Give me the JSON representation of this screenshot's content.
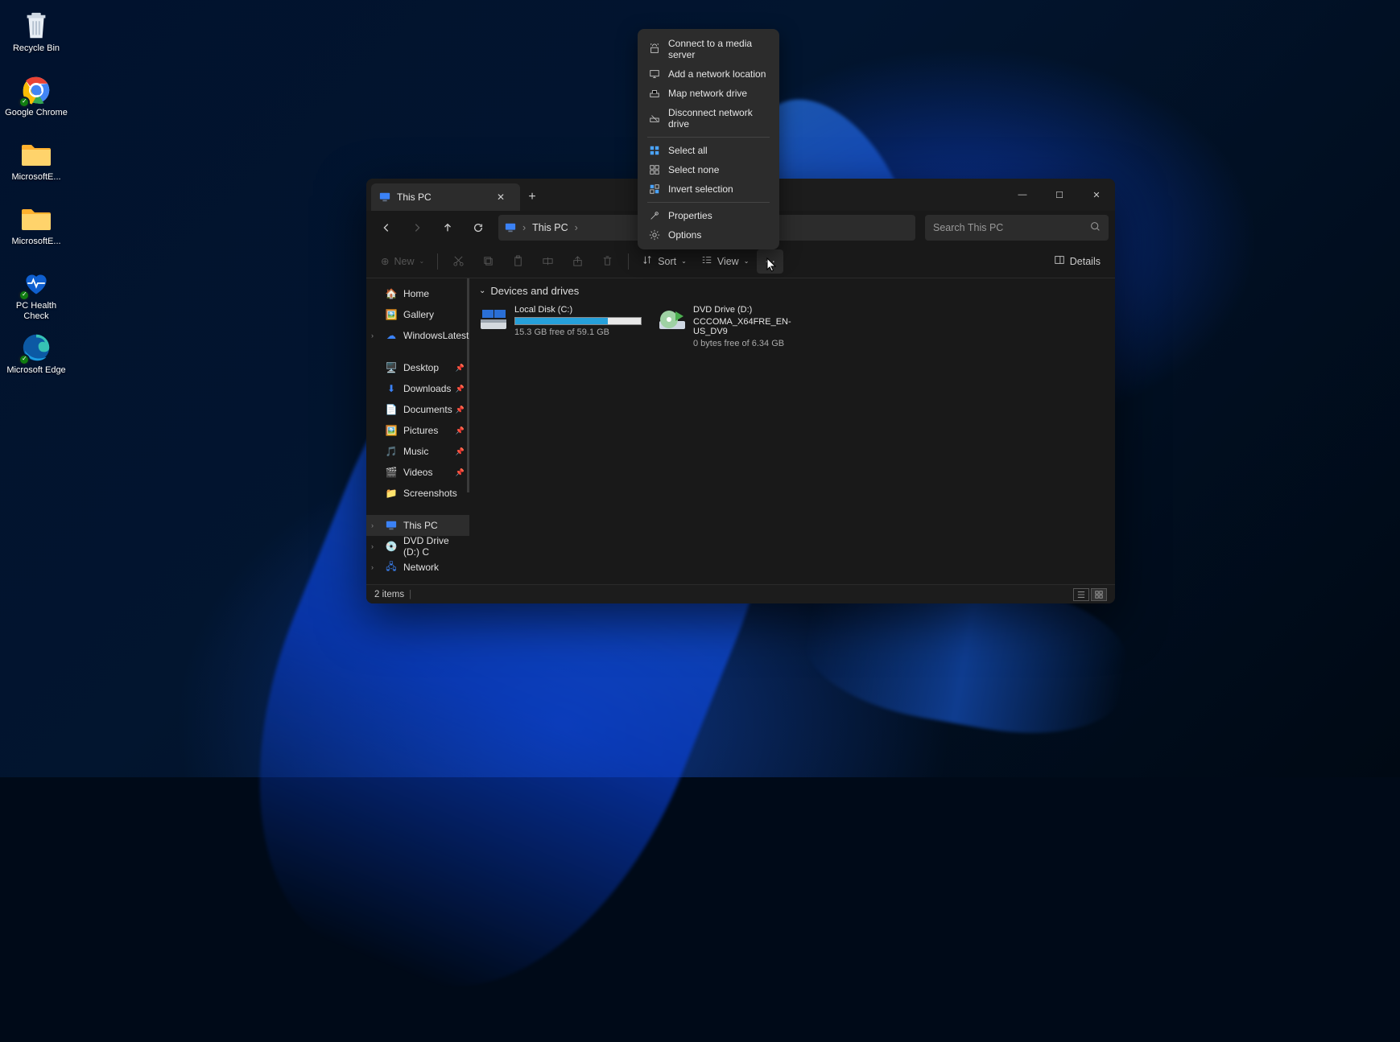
{
  "desktop": {
    "icons": [
      {
        "name": "recycle-bin",
        "label": "Recycle Bin"
      },
      {
        "name": "google-chrome",
        "label": "Google Chrome"
      },
      {
        "name": "microsoft-edge-folder-1",
        "label": "MicrosoftE..."
      },
      {
        "name": "microsoft-edge-folder-2",
        "label": "MicrosoftE..."
      },
      {
        "name": "pc-health-check",
        "label": "PC Health Check"
      },
      {
        "name": "microsoft-edge",
        "label": "Microsoft Edge"
      }
    ]
  },
  "explorer": {
    "tab_title": "This PC",
    "breadcrumb": {
      "root_icon": "pc-icon",
      "location": "This PC"
    },
    "search_placeholder": "Search This PC",
    "toolbar": {
      "new_label": "New",
      "sort_label": "Sort",
      "view_label": "View",
      "details_label": "Details"
    },
    "sidebar": {
      "home": "Home",
      "gallery": "Gallery",
      "windowslatest": "WindowsLatest",
      "desktop": "Desktop",
      "downloads": "Downloads",
      "documents": "Documents",
      "pictures": "Pictures",
      "music": "Music",
      "videos": "Videos",
      "screenshots": "Screenshots",
      "this_pc": "This PC",
      "dvd_drive": "DVD Drive (D:) C",
      "network": "Network"
    },
    "content": {
      "group_header": "Devices and drives",
      "drives": [
        {
          "name": "Local Disk (C:)",
          "free_text": "15.3 GB free of 59.1 GB",
          "fill_pct": 74
        },
        {
          "name": "DVD Drive (D:)",
          "sub": "CCCOMA_X64FRE_EN-US_DV9",
          "free_text": "0 bytes free of 6.34 GB"
        }
      ]
    },
    "status": {
      "items_text": "2 items"
    }
  },
  "context_menu": {
    "items": [
      {
        "icon": "media-server-icon",
        "label": "Connect to a media server"
      },
      {
        "icon": "network-location-icon",
        "label": "Add a network location"
      },
      {
        "icon": "map-drive-icon",
        "label": "Map network drive"
      },
      {
        "icon": "disconnect-drive-icon",
        "label": "Disconnect network drive"
      }
    ],
    "items2": [
      {
        "icon": "select-all-icon",
        "label": "Select all"
      },
      {
        "icon": "select-none-icon",
        "label": "Select none"
      },
      {
        "icon": "invert-selection-icon",
        "label": "Invert selection"
      }
    ],
    "items3": [
      {
        "icon": "properties-icon",
        "label": "Properties"
      },
      {
        "icon": "options-icon",
        "label": "Options"
      }
    ]
  }
}
